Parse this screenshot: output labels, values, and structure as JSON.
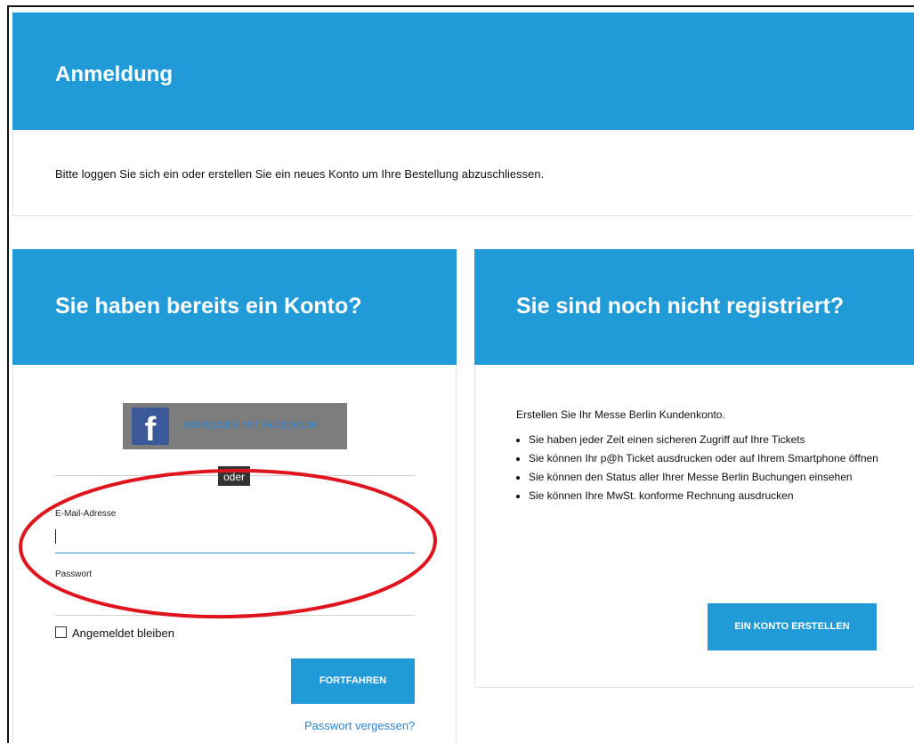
{
  "header": {
    "title": "Anmeldung",
    "intro": "Bitte loggen Sie sich ein oder erstellen Sie ein neues Konto um Ihre Bestellung abzuschliessen."
  },
  "login": {
    "title": "Sie haben bereits ein Konto?",
    "facebook_label": "ANMELDEN MIT FACEBOOK",
    "facebook_icon": "f",
    "or_label": "oder",
    "email_label": "E-Mail-Adresse",
    "email_value": "",
    "password_label": "Passwort",
    "password_value": "",
    "remember_label": "Angemeldet bleiben",
    "remember_checked": false,
    "continue_label": "FORTFAHREN",
    "forgot_label": "Passwort vergessen?"
  },
  "register": {
    "title": "Sie sind noch nicht registriert?",
    "intro": "Erstellen Sie Ihr Messe Berlin Kundenkonto.",
    "benefits": [
      "Sie haben jeder Zeit einen sicheren Zugriff auf Ihre Tickets",
      "Sie können Ihr p@h Ticket ausdrucken oder auf Ihrem Smartphone öffnen",
      "Sie können den Status aller Ihrer Messe Berlin Buchungen einsehen",
      "Sie können Ihre MwSt. konforme Rechnung ausdrucken"
    ],
    "create_label": "EIN KONTO ERSTELLEN"
  },
  "colors": {
    "accent": "#219bd8",
    "facebook": "#3b5998",
    "annotation": "#e0141c"
  }
}
